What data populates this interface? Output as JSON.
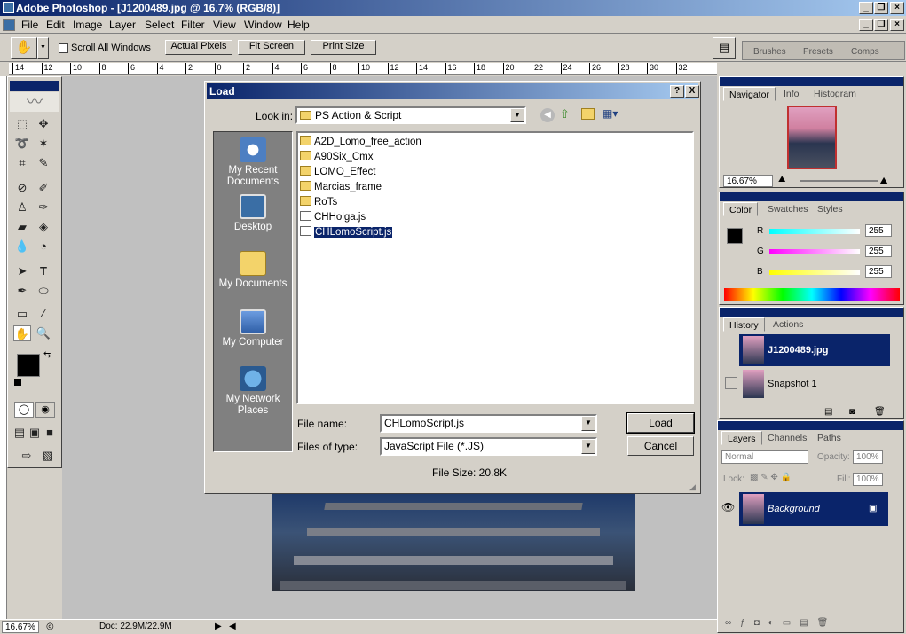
{
  "app": {
    "title": "Adobe Photoshop - [J1200489.jpg @ 16.7% (RGB/8)]"
  },
  "menu": [
    "File",
    "Edit",
    "Image",
    "Layer",
    "Select",
    "Filter",
    "View",
    "Window",
    "Help"
  ],
  "options": {
    "scroll_all": "Scroll All Windows",
    "actual_pixels": "Actual Pixels",
    "fit_screen": "Fit Screen",
    "print_size": "Print Size"
  },
  "wells": [
    "Brushes",
    "Presets",
    "Comps"
  ],
  "ruler_ticks": [
    "14",
    "12",
    "10",
    "8",
    "6",
    "4",
    "2",
    "0",
    "2",
    "4",
    "6",
    "8",
    "10",
    "12",
    "14",
    "16",
    "18",
    "20",
    "22",
    "24",
    "26",
    "28",
    "30",
    "32"
  ],
  "dialog": {
    "title": "Load",
    "look_in_label": "Look in:",
    "look_in_value": "PS Action & Script",
    "places": [
      "My Recent Documents",
      "Desktop",
      "My Documents",
      "My Computer",
      "My Network Places"
    ],
    "files": [
      "A2D_Lomo_free_action",
      "A90Six_Cmx",
      "LOMO_Effect",
      "Marcias_frame",
      "RoTs",
      "CHHolga.js",
      "CHLomoScript.js"
    ],
    "file_name_label": "File name:",
    "file_name_value": "CHLomoScript.js",
    "file_type_label": "Files of type:",
    "file_type_value": "JavaScript File (*.JS)",
    "load_button": "Load",
    "cancel_button": "Cancel",
    "file_size": "File Size: 20.8K",
    "help": "?",
    "close": "X"
  },
  "navigator": {
    "tabs": [
      "Navigator",
      "Info",
      "Histogram"
    ],
    "zoom": "16.67%"
  },
  "color": {
    "tabs": [
      "Color",
      "Swatches",
      "Styles"
    ],
    "r_label": "R",
    "g_label": "G",
    "b_label": "B",
    "r": "255",
    "g": "255",
    "b": "255"
  },
  "history": {
    "tabs": [
      "History",
      "Actions"
    ],
    "items": [
      "J1200489.jpg",
      "Snapshot 1"
    ]
  },
  "layers": {
    "tabs": [
      "Layers",
      "Channels",
      "Paths"
    ],
    "blend_mode": "Normal",
    "opacity_label": "Opacity:",
    "opacity": "100%",
    "lock_label": "Lock:",
    "fill_label": "Fill:",
    "fill": "100%",
    "layer_name": "Background"
  },
  "status": {
    "zoom": "16.67%",
    "doc": "Doc: 22.9M/22.9M"
  },
  "colors": {
    "title_dark": "#0a246a",
    "title_light": "#a6caf0",
    "panel": "#d4d0c8"
  }
}
